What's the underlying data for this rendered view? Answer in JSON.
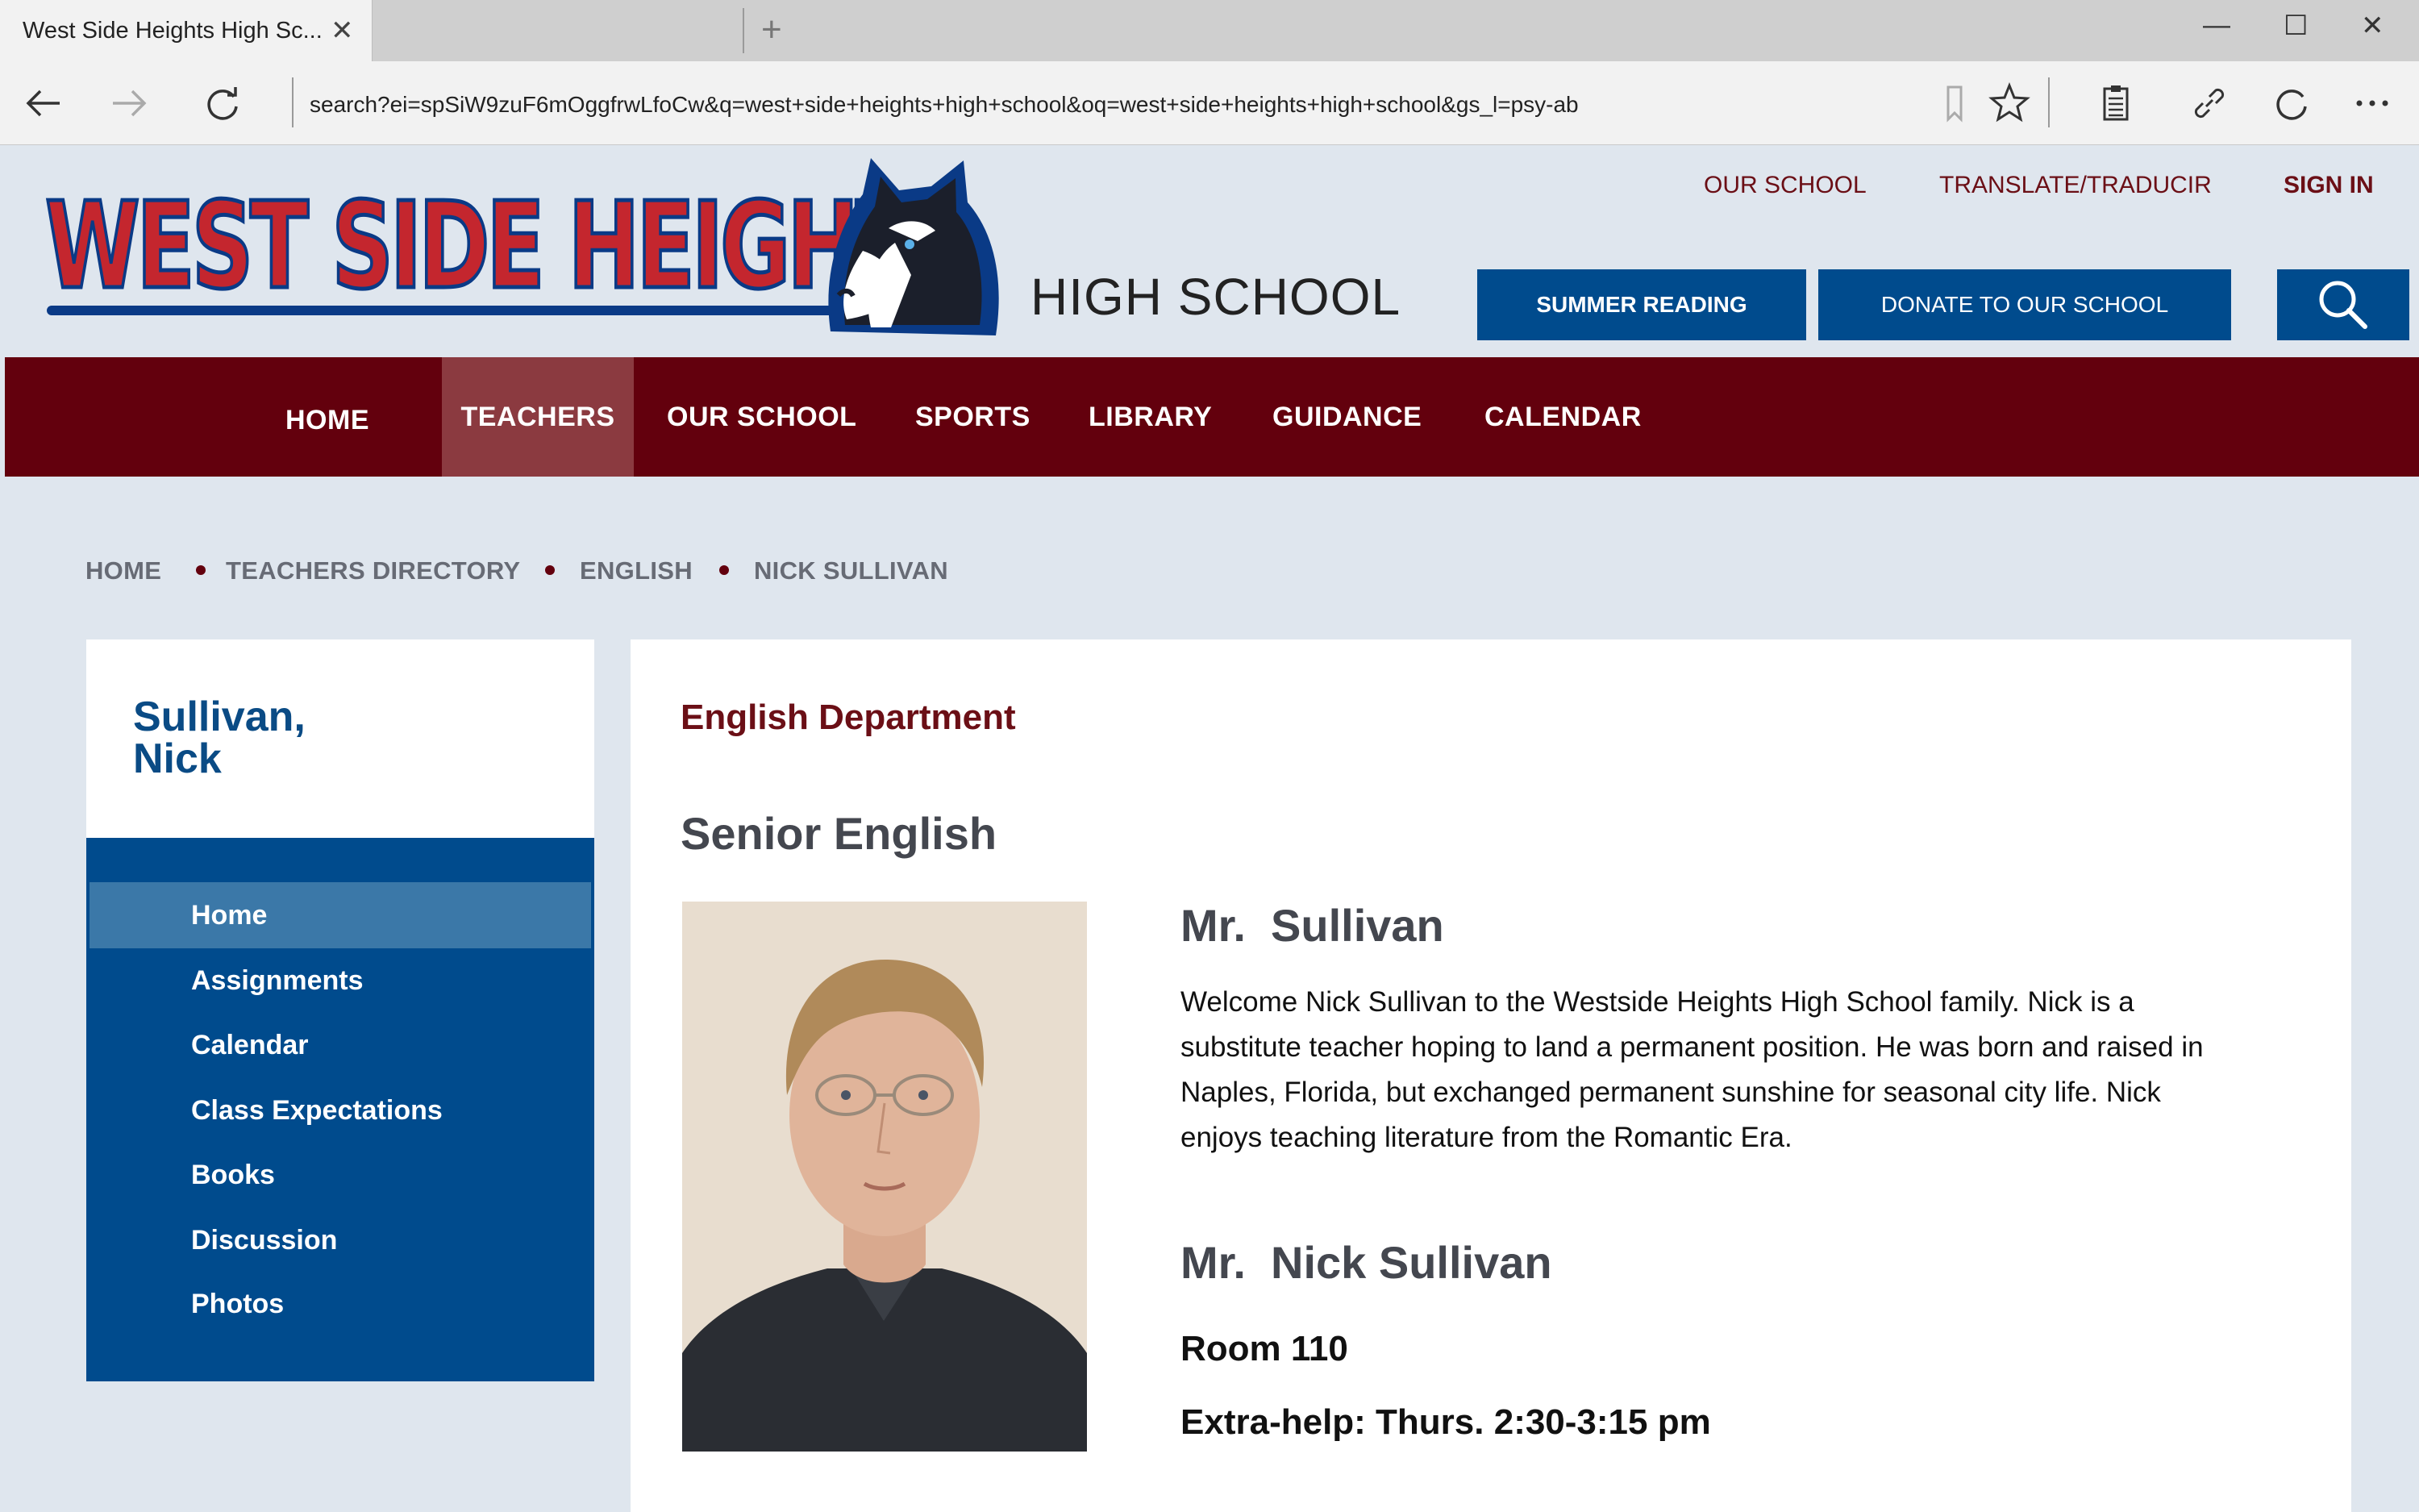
{
  "browser": {
    "tab_title": "West Side Heights High Sc...",
    "url": "search?ei=spSiW9zuF6mOggfrwLfoCw&q=west+side+heights+high+school&oq=west+side+heights+high+school&gs_l=psy-ab"
  },
  "site": {
    "logo_text": "WEST SIDE HEIGHTS",
    "logo_subtitle": "HIGH SCHOOL",
    "top_links": [
      "OUR SCHOOL",
      "TRANSLATE/TRADUCIR",
      "SIGN IN"
    ],
    "buttons": {
      "summer_reading": "SUMMER READING",
      "donate": "DONATE TO OUR SCHOOL"
    },
    "nav": [
      "HOME",
      "TEACHERS",
      "OUR SCHOOL",
      "SPORTS",
      "LIBRARY",
      "GUIDANCE",
      "CALENDAR"
    ],
    "nav_active": "TEACHERS",
    "colors": {
      "maroon": "#63000d",
      "blue": "#004b8d",
      "logo_red": "#c4262e"
    }
  },
  "breadcrumb": [
    "HOME",
    "TEACHERS DIRECTORY",
    "ENGLISH",
    "NICK SULLIVAN"
  ],
  "sidebar": {
    "name": "Sullivan,\nNick",
    "menu": [
      "Home",
      "Assignments",
      "Calendar",
      "Class Expectations",
      "Books",
      "Discussion",
      "Photos"
    ],
    "active": "Home"
  },
  "content": {
    "department": "English Department",
    "course": "Senior English",
    "bio_title": "Mr.  Sullivan",
    "bio": "Welcome Nick Sullivan to the Westside Heights High School family. Nick is a substitute teacher hoping to land a permanent position. He was born and raised in Naples, Florida, but exchanged permanent sunshine for seasonal city life. Nick enjoys teaching literature from the Romantic Era.",
    "full_name": "Mr.  Nick Sullivan",
    "room": "Room 110",
    "extra_help": "Extra-help: Thurs. 2:30-3:15 pm"
  }
}
